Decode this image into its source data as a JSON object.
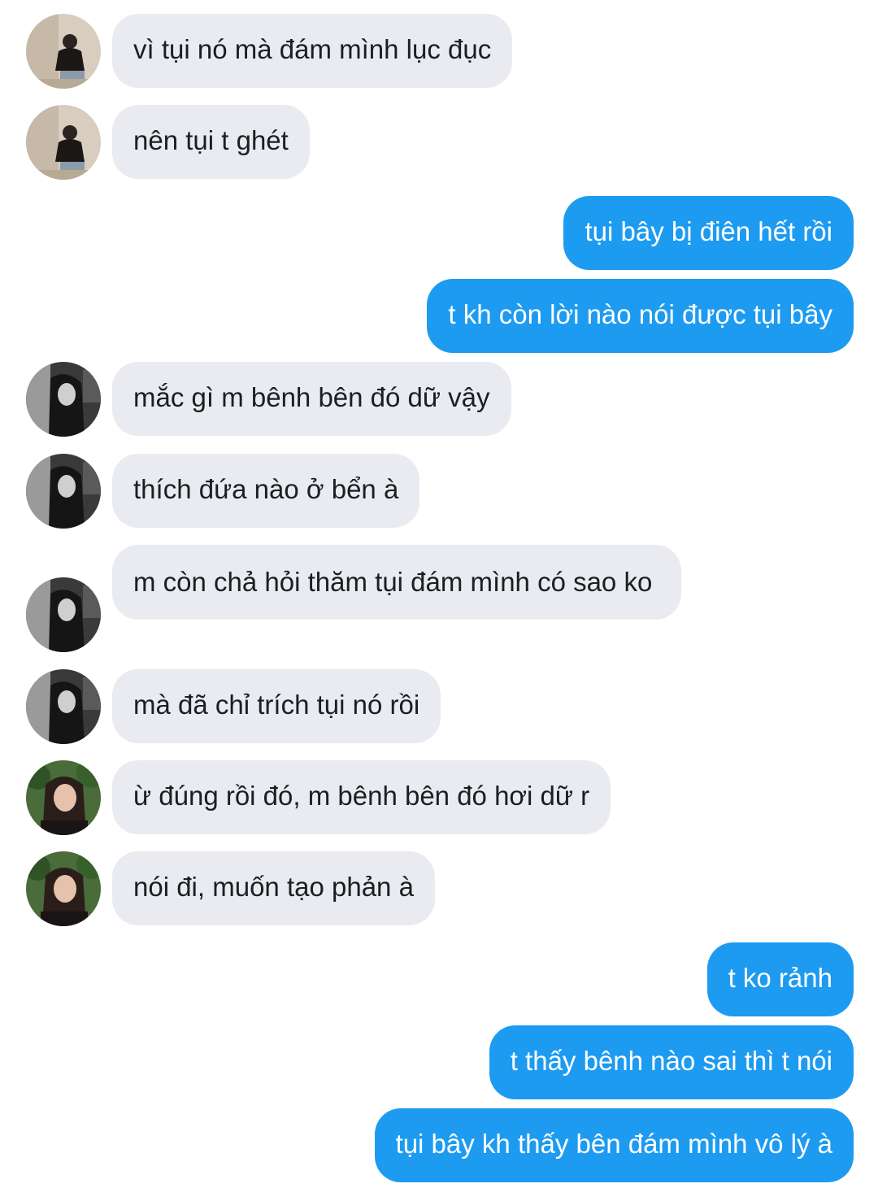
{
  "colors": {
    "incoming_bubble": "#e9ebf0",
    "outgoing_bubble": "#1d9bf0",
    "incoming_text": "#1c1e21",
    "outgoing_text": "#ffffff"
  },
  "messages": [
    {
      "direction": "incoming",
      "avatar": "user-a-avatar",
      "text": "vì tụi nó mà đám mình lục đục"
    },
    {
      "direction": "incoming",
      "avatar": "user-a-avatar",
      "text": "nên tụi t ghét"
    },
    {
      "direction": "outgoing",
      "text": "tụi bây bị điên hết rồi"
    },
    {
      "direction": "outgoing",
      "text": "t kh còn lời nào nói được tụi bây"
    },
    {
      "direction": "incoming",
      "avatar": "user-b-avatar",
      "text": "mắc gì m bênh bên đó dữ vậy"
    },
    {
      "direction": "incoming",
      "avatar": "user-b-avatar",
      "text": "thích đứa nào ở bển à"
    },
    {
      "direction": "incoming",
      "avatar": "user-b-avatar",
      "text": "m còn chả hỏi thăm tụi đám mình có sao ko"
    },
    {
      "direction": "incoming",
      "avatar": "user-b-avatar",
      "text": "mà đã chỉ trích tụi nó rồi"
    },
    {
      "direction": "incoming",
      "avatar": "user-c-avatar",
      "text": "ừ đúng rồi đó, m bênh bên đó hơi dữ r"
    },
    {
      "direction": "incoming",
      "avatar": "user-c-avatar",
      "text": "nói đi, muốn tạo phản à"
    },
    {
      "direction": "outgoing",
      "text": "t ko rảnh"
    },
    {
      "direction": "outgoing",
      "text": "t thấy bênh nào sai thì t nói"
    },
    {
      "direction": "outgoing",
      "text": "tụi bây kh thấy bên đám mình vô lý à"
    }
  ]
}
